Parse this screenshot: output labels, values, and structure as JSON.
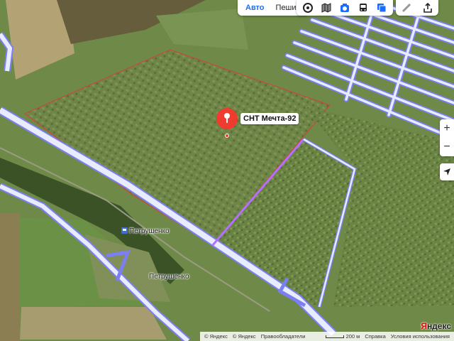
{
  "routing": {
    "modes": [
      {
        "label": "Авто",
        "active": true
      },
      {
        "label": "Пешие",
        "active": false
      }
    ]
  },
  "layers_toolbar": {
    "icons": [
      "panorama-icon",
      "layers-icon",
      "camera-icon",
      "bus-icon",
      "traffic-icon"
    ]
  },
  "tools": {
    "icons": [
      "ruler-icon",
      "share-icon"
    ]
  },
  "controls": {
    "zoom_in": "+",
    "zoom_out": "−"
  },
  "poi": {
    "label": "СНТ Мечта-92",
    "marker_color": "#f03b2f",
    "icon": "location-pin-icon"
  },
  "labels": {
    "station": "Петрушенко",
    "village": "Петрушенко"
  },
  "footer": {
    "copyright1": "© Яндекс",
    "copyright2": "© Яндекс",
    "rights_holders": "Правообладатели",
    "scale": "200 м",
    "help": "Справка",
    "terms": "Условия использования"
  },
  "brand": {
    "prefix": "Я",
    "rest": "ндекс"
  },
  "colors": {
    "boundary": "#c8483c",
    "road_fill": "#e9ecff",
    "road_edge": "#7b7ff0",
    "purple_road": "#b56fff"
  }
}
